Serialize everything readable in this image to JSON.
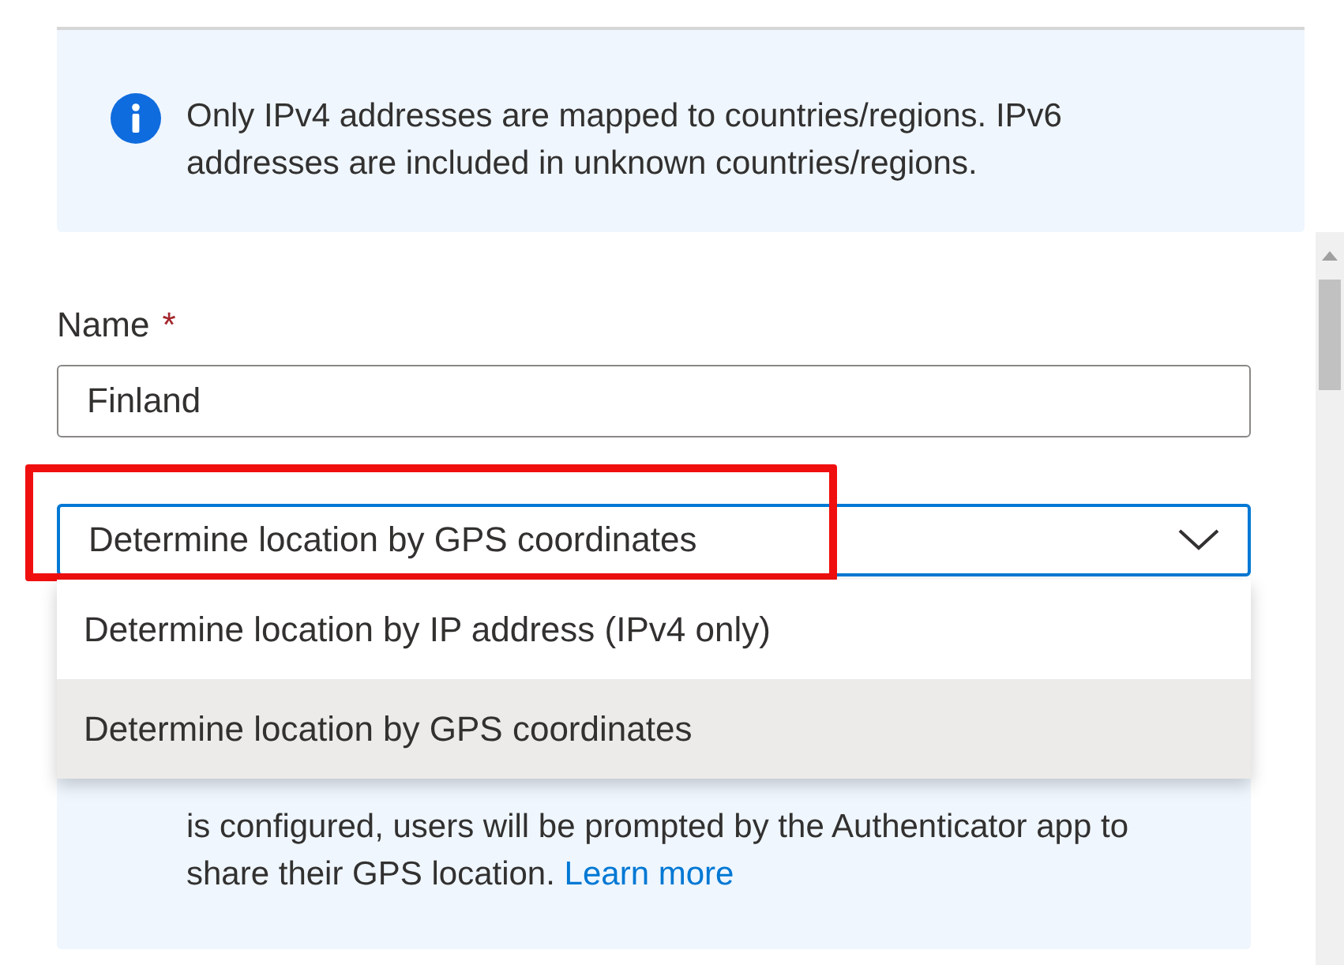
{
  "info_banner": {
    "text": "Only IPv4 addresses are mapped to countries/regions. IPv6 addresses are included in unknown countries/regions."
  },
  "name_field": {
    "label": "Name",
    "required_mark": "*",
    "value": "Finland"
  },
  "location_dropdown": {
    "value": "Determine location by GPS coordinates",
    "expanded": true,
    "highlighted": true,
    "options": [
      {
        "label": "Determine location by IP address (IPv4 only)",
        "selected": false
      },
      {
        "label": "Determine location by GPS coordinates",
        "selected": true
      }
    ]
  },
  "gps_info": {
    "text": "is configured, users will be prompted by the Authenticator app to share their GPS location.",
    "link": "Learn more"
  }
}
